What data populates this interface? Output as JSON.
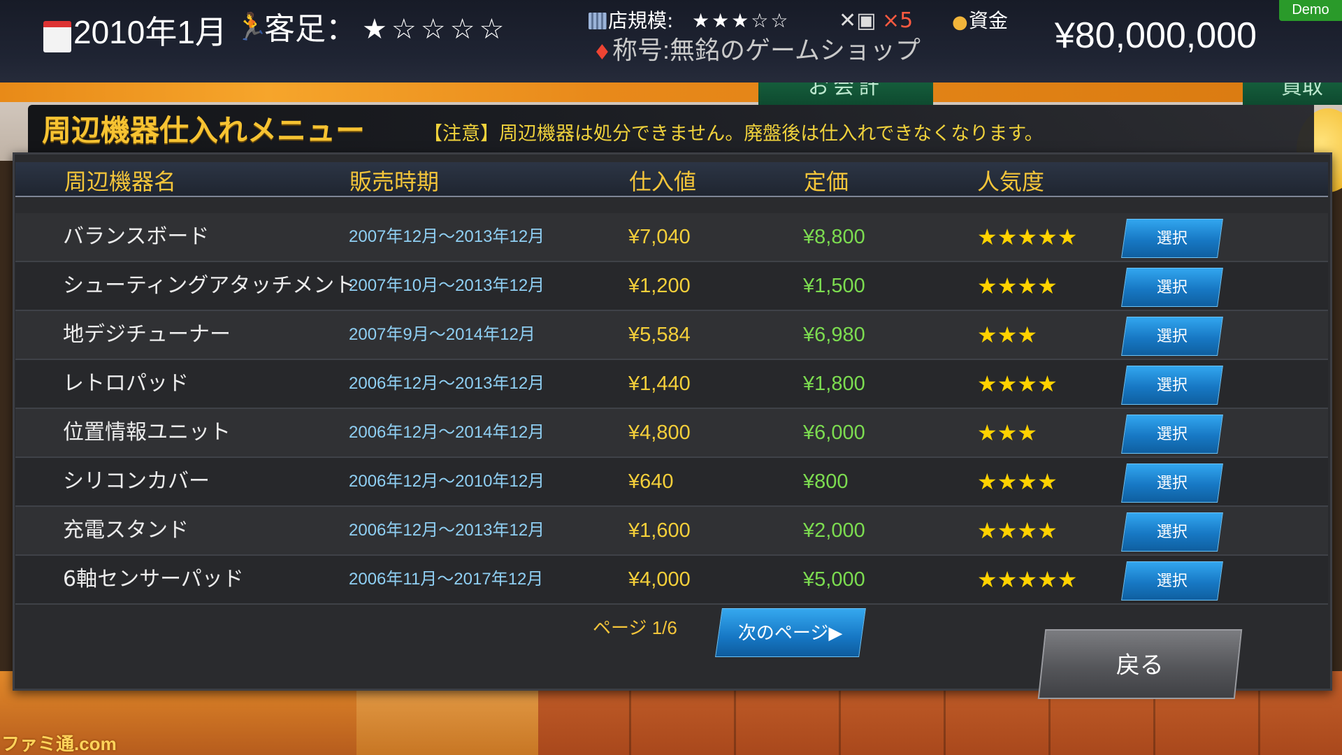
{
  "hud": {
    "date": "2010年1月",
    "customers_label": "客足：",
    "customers_stars": "★☆☆☆☆",
    "shop_scale_label": "店規模:",
    "shop_scale_stars": "★★★☆☆",
    "tools_count": "×5",
    "funds_label": "資金",
    "funds": "¥80,000,000",
    "title": "称号:無銘のゲームショップ",
    "demo": "Demo"
  },
  "background": {
    "sign_checkout": "お会計",
    "sign_buy": "買取"
  },
  "panel": {
    "title": "周辺機器仕入れメニュー",
    "notice": "【注意】周辺機器は処分できません。廃盤後は仕入れできなくなります。",
    "columns": [
      "周辺機器名",
      "販売時期",
      "仕入値",
      "定価",
      "人気度"
    ],
    "rows": [
      {
        "name": "バランスボード",
        "period": "2007年12月～2013年12月",
        "cost": "¥7,040",
        "price": "¥8,800",
        "stars": "★★★★★",
        "button": "選択"
      },
      {
        "name": "シューティングアタッチメント",
        "period": "2007年10月～2013年12月",
        "cost": "¥1,200",
        "price": "¥1,500",
        "stars": "★★★★",
        "button": "選択"
      },
      {
        "name": "地デジチューナー",
        "period": "2007年9月～2014年12月",
        "cost": "¥5,584",
        "price": "¥6,980",
        "stars": "★★★",
        "button": "選択"
      },
      {
        "name": "レトロパッド",
        "period": "2006年12月～2013年12月",
        "cost": "¥1,440",
        "price": "¥1,800",
        "stars": "★★★★",
        "button": "選択"
      },
      {
        "name": "位置情報ユニット",
        "period": "2006年12月～2014年12月",
        "cost": "¥4,800",
        "price": "¥6,000",
        "stars": "★★★",
        "button": "選択"
      },
      {
        "name": "シリコンカバー",
        "period": "2006年12月～2010年12月",
        "cost": "¥640",
        "price": "¥800",
        "stars": "★★★★",
        "button": "選択"
      },
      {
        "name": "充電スタンド",
        "period": "2006年12月～2013年12月",
        "cost": "¥1,600",
        "price": "¥2,000",
        "stars": "★★★★",
        "button": "選択"
      },
      {
        "name": "6軸センサーパッド",
        "period": "2006年11月～2017年12月",
        "cost": "¥4,000",
        "price": "¥5,000",
        "stars": "★★★★★",
        "button": "選択"
      }
    ],
    "page_label": "ページ 1/6",
    "next_button": "次のページ▶",
    "back_button": "戻る"
  },
  "watermark": "ファミ通.com",
  "icons": {
    "calendar": "calendar-icon",
    "runner": "runner-icon",
    "shop": "shop-building-icon",
    "tools": "tools-icon",
    "money": "money-bag-icon",
    "medal": "medal-icon"
  },
  "colors": {
    "accent_yellow": "#f4c53a",
    "period_blue": "#8fcff3",
    "price_green": "#7cdc50",
    "button_blue": "#1778c4"
  }
}
